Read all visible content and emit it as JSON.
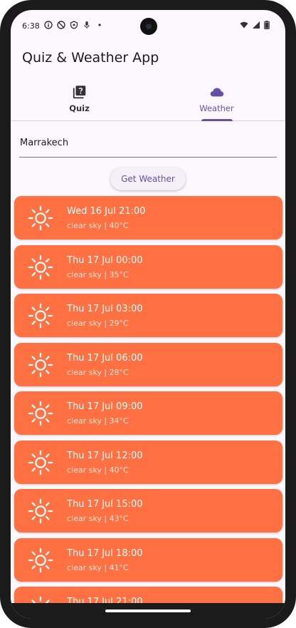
{
  "status_bar": {
    "time": "6:38"
  },
  "app": {
    "title": "Quiz & Weather App"
  },
  "tabs": [
    {
      "label": "Quiz",
      "icon": "quiz-icon",
      "selected": false
    },
    {
      "label": "Weather",
      "icon": "cloud-icon",
      "selected": true
    }
  ],
  "search": {
    "value": "Marrakech"
  },
  "button": {
    "label": "Get Weather"
  },
  "colors": {
    "accent": "#6750a4",
    "card": "#ff7043"
  },
  "forecast": [
    {
      "datetime": "Wed 16 Jul 21:00",
      "summary": "clear sky | 40°C"
    },
    {
      "datetime": "Thu 17 Jul 00:00",
      "summary": "clear sky | 35°C"
    },
    {
      "datetime": "Thu 17 Jul 03:00",
      "summary": "clear sky | 29°C"
    },
    {
      "datetime": "Thu 17 Jul 06:00",
      "summary": "clear sky | 28°C"
    },
    {
      "datetime": "Thu 17 Jul 09:00",
      "summary": "clear sky | 34°C"
    },
    {
      "datetime": "Thu 17 Jul 12:00",
      "summary": "clear sky | 40°C"
    },
    {
      "datetime": "Thu 17 Jul 15:00",
      "summary": "clear sky | 43°C"
    },
    {
      "datetime": "Thu 17 Jul 18:00",
      "summary": "clear sky | 41°C"
    },
    {
      "datetime": "Thu 17 Jul 21:00",
      "summary": ""
    }
  ]
}
